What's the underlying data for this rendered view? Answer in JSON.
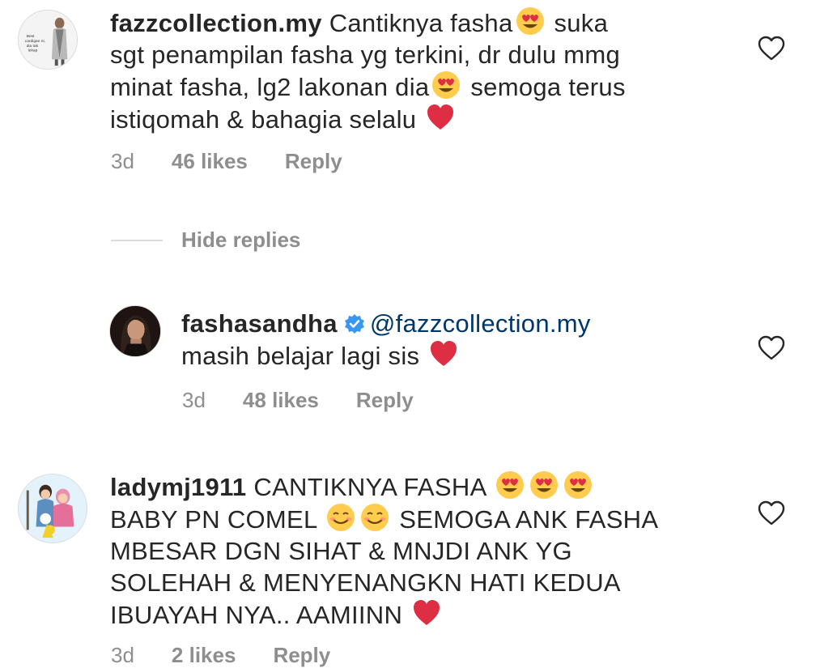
{
  "comments": [
    {
      "username": "fazzcollection.my",
      "line1": "Cantiknya fasha",
      "line1b": "suka",
      "line2": "sgt penampilan fasha yg terkini, dr dulu mmg",
      "line3": "minat fasha, lg2 lakonan dia",
      "line3b": "semoga terus",
      "line4": "istiqomah & bahagia selalu",
      "avatar_text": "\"Best cardigan ni, dia tak lekap\"",
      "time": "3d",
      "likes": "46 likes",
      "reply": "Reply"
    },
    {
      "username": "fashasandha",
      "mention": "@fazzcollection.my",
      "line2": "masih belajar lagi sis",
      "time": "3d",
      "likes": "48 likes",
      "reply": "Reply"
    },
    {
      "username": "ladymj1911",
      "line1": "CANTIKNYA FASHA",
      "line2": "BABY PN COMEL",
      "line2b": "SEMOGA ANK FASHA",
      "line3": "MBESAR DGN SIHAT & MNJDI ANK YG",
      "line4": "SOLEHAH & MENYENANGKN HATI KEDUA",
      "line5": "IBUAYAH NYA.. AAMIINN",
      "time": "3d",
      "likes": "2 likes",
      "reply": "Reply"
    }
  ],
  "hide_replies": "Hide replies",
  "colors": {
    "text": "#262626",
    "muted": "#8e8e8e",
    "mention": "#00376b",
    "verified": "#3897f0",
    "heart_red": "#ed4956"
  },
  "icons": [
    "heart-outline-icon",
    "heart-eyes-emoji",
    "red-heart-emoji",
    "smiling-emoji",
    "verified-badge-icon"
  ]
}
